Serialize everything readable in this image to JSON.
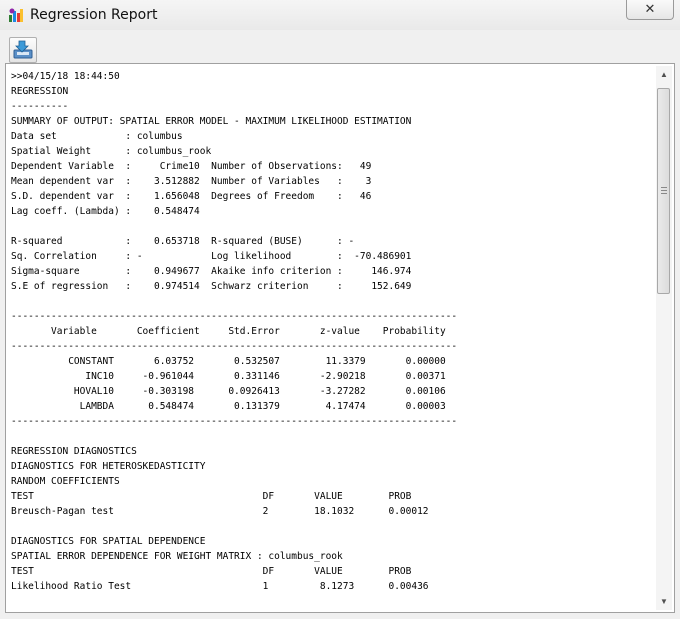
{
  "window": {
    "title": "Regression Report",
    "close_symbol": "✕"
  },
  "toolbar": {
    "save_icon": "save-arrow-icon"
  },
  "report": {
    "lines": [
      ">>04/15/18 18:44:50",
      "REGRESSION",
      "----------",
      "SUMMARY OF OUTPUT: SPATIAL ERROR MODEL - MAXIMUM LIKELIHOOD ESTIMATION",
      "Data set            : columbus",
      "Spatial Weight      : columbus_rook",
      "Dependent Variable  :     Crime10  Number of Observations:   49",
      "Mean dependent var  :    3.512882  Number of Variables   :    3",
      "S.D. dependent var  :    1.656048  Degrees of Freedom    :   46",
      "Lag coeff. (Lambda) :    0.548474",
      "",
      "R-squared           :    0.653718  R-squared (BUSE)      : -",
      "Sq. Correlation     : -            Log likelihood        :  -70.486901",
      "Sigma-square        :    0.949677  Akaike info criterion :     146.974",
      "S.E of regression   :    0.974514  Schwarz criterion     :     152.649",
      "",
      "------------------------------------------------------------------------------",
      "       Variable       Coefficient     Std.Error       z-value    Probability",
      "------------------------------------------------------------------------------",
      "          CONSTANT       6.03752       0.532507        11.3379       0.00000",
      "             INC10     -0.961044       0.331146       -2.90218       0.00371",
      "           HOVAL10     -0.303198      0.0926413       -3.27282       0.00106",
      "            LAMBDA      0.548474       0.131379        4.17474       0.00003",
      "------------------------------------------------------------------------------",
      "",
      "REGRESSION DIAGNOSTICS",
      "DIAGNOSTICS FOR HETEROSKEDASTICITY",
      "RANDOM COEFFICIENTS",
      "TEST                                        DF       VALUE        PROB",
      "Breusch-Pagan test                          2        18.1032      0.00012",
      "",
      "DIAGNOSTICS FOR SPATIAL DEPENDENCE",
      "SPATIAL ERROR DEPENDENCE FOR WEIGHT MATRIX : columbus_rook",
      "TEST                                        DF       VALUE        PROB",
      "Likelihood Ratio Test                       1         8.1273      0.00436",
      ""
    ]
  },
  "scrollbar": {
    "up_arrow": "▲",
    "down_arrow": "▼"
  }
}
